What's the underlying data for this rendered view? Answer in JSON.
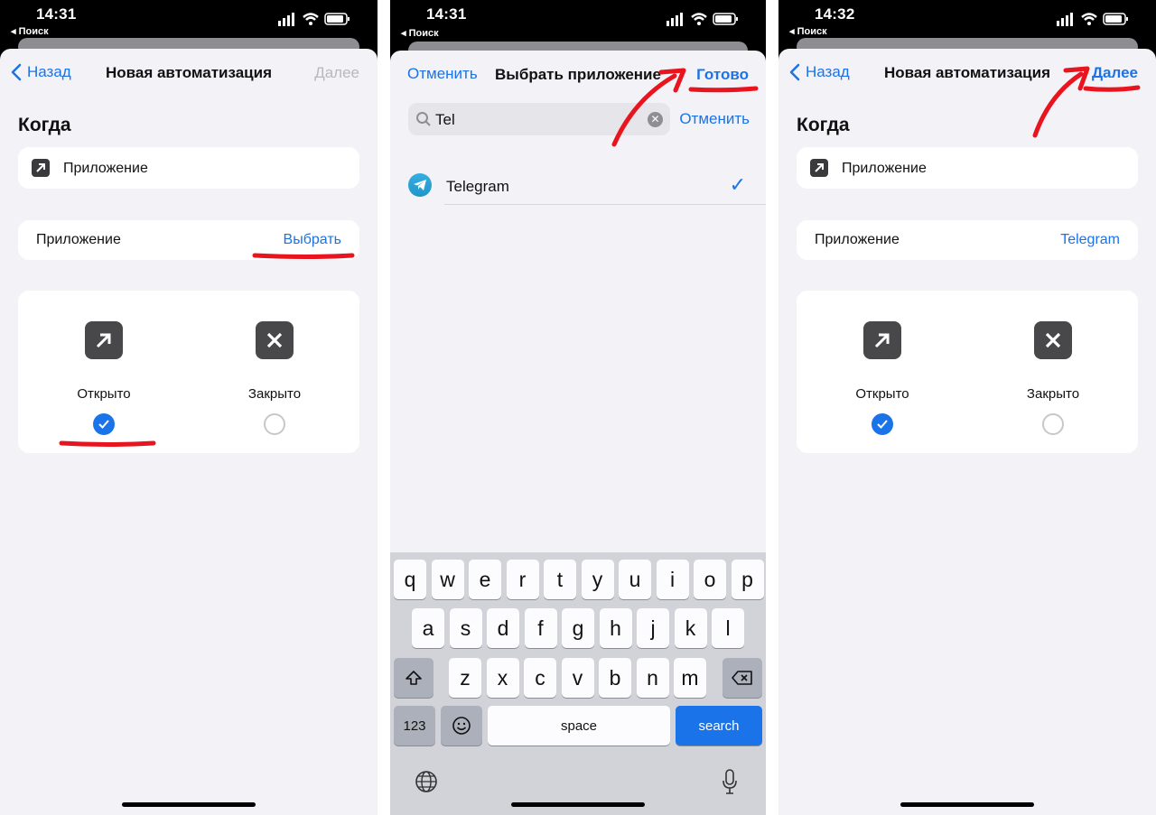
{
  "screen1": {
    "status": {
      "time": "14:31",
      "back_app": "◂ Поиск"
    },
    "nav": {
      "back": "Назад",
      "title": "Новая автоматизация",
      "next": "Далее"
    },
    "section_title": "Когда",
    "trigger_label": "Приложение",
    "app_row": {
      "label": "Приложение",
      "value": "Выбрать"
    },
    "options": {
      "opened": "Открыто",
      "closed": "Закрыто"
    }
  },
  "screen2": {
    "status": {
      "time": "14:31",
      "back_app": "◂ Поиск"
    },
    "nav": {
      "cancel": "Отменить",
      "title": "Выбрать приложение",
      "done": "Готово"
    },
    "search": {
      "query": "Tel",
      "cancel": "Отменить"
    },
    "result": {
      "name": "Telegram"
    },
    "keyboard": {
      "row1": [
        "q",
        "w",
        "e",
        "r",
        "t",
        "y",
        "u",
        "i",
        "o",
        "p"
      ],
      "row2": [
        "a",
        "s",
        "d",
        "f",
        "g",
        "h",
        "j",
        "k",
        "l"
      ],
      "row3": [
        "z",
        "x",
        "c",
        "v",
        "b",
        "n",
        "m"
      ],
      "numbers": "123",
      "space": "space",
      "search": "search"
    }
  },
  "screen3": {
    "status": {
      "time": "14:32",
      "back_app": "◂ Поиск"
    },
    "nav": {
      "back": "Назад",
      "title": "Новая автоматизация",
      "next": "Далее"
    },
    "section_title": "Когда",
    "trigger_label": "Приложение",
    "app_row": {
      "label": "Приложение",
      "value": "Telegram"
    },
    "options": {
      "opened": "Открыто",
      "closed": "Закрыто"
    }
  },
  "colors": {
    "accent": "#1a73e8",
    "annotation": "#e8141e",
    "background": "#f2f2f7"
  }
}
